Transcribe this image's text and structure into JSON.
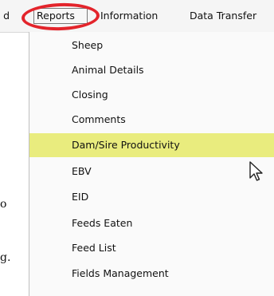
{
  "menubar": {
    "prev_partial": "d",
    "items": [
      "Reports",
      "Information",
      "Data Transfer"
    ]
  },
  "reports_menu": {
    "items": [
      {
        "label": "Sheep",
        "selected": false
      },
      {
        "label": "Animal Details",
        "selected": false
      },
      {
        "label": "Closing",
        "selected": false
      },
      {
        "label": "Comments",
        "selected": false
      },
      {
        "label": "Dam/Sire Productivity",
        "selected": true
      },
      {
        "label": "EBV",
        "selected": false
      },
      {
        "label": "EID",
        "selected": false
      },
      {
        "label": "Feeds Eaten",
        "selected": false
      },
      {
        "label": "Feed List",
        "selected": false
      },
      {
        "label": "Fields Management",
        "selected": false
      }
    ]
  },
  "left_text": {
    "line1": "o",
    "line2": "g."
  },
  "colors": {
    "highlight": "#e9ec7e",
    "ring": "#e3242b"
  }
}
